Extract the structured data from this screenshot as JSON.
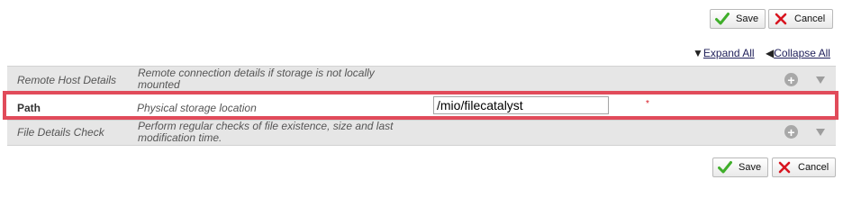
{
  "toolbar": {
    "save_label": "Save",
    "cancel_label": "Cancel"
  },
  "links": {
    "expand_all": "Expand All",
    "collapse_all": "Collapse All"
  },
  "rows": [
    {
      "name": "Remote Host Details",
      "description": "Remote connection details if storage is not locally mounted",
      "collapsed": true
    },
    {
      "name": "Path",
      "description": "Physical storage location",
      "value": "/mio/filecatalyst",
      "required": true,
      "required_marker": "*"
    },
    {
      "name": "File Details Check",
      "description": "Perform regular checks of file existence, size and last modification time.",
      "collapsed": true
    }
  ],
  "icons": {
    "save": "check-icon",
    "cancel": "x-icon",
    "expand": "plus-icon",
    "row_toggle": "caret-down-icon"
  },
  "colors": {
    "highlight_border": "#e14b5a",
    "check": "#3fae2a",
    "cancel_x": "#d8141f",
    "required": "#d8141f"
  }
}
